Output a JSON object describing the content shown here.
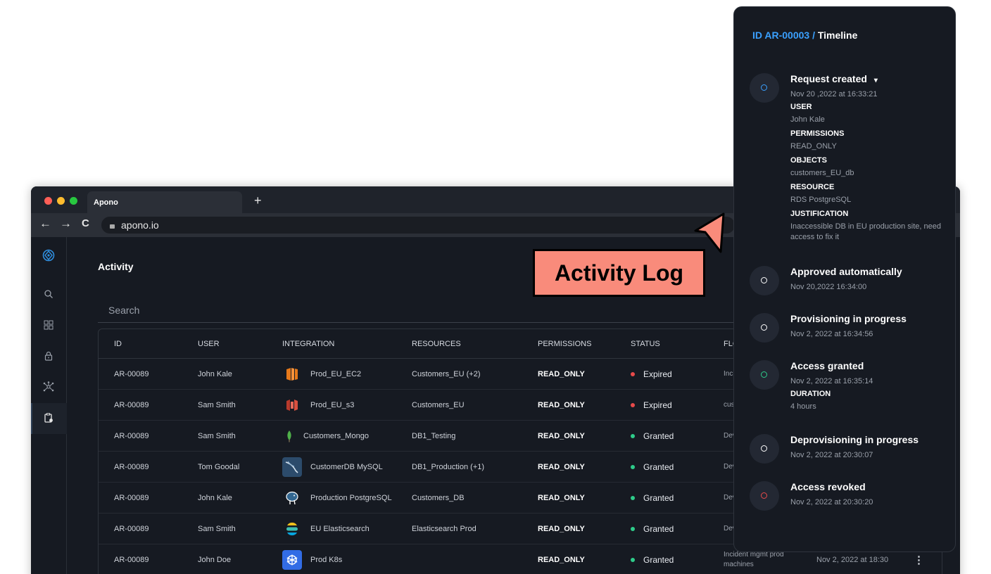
{
  "browser": {
    "tab_title": "Apono",
    "new_tab": "+",
    "url": "apono.io",
    "back": "←",
    "forward": "→",
    "reload": "C"
  },
  "page": {
    "title": "Activity",
    "search_placeholder": "Search"
  },
  "table": {
    "columns": [
      "ID",
      "USER",
      "INTEGRATION",
      "RESOURCES",
      "PERMISSIONS",
      "STATUS",
      "FLO"
    ],
    "rows": [
      {
        "id": "AR-00089",
        "user": "John Kale",
        "integration": "Prod_EU_EC2",
        "icon": "aws-ec2-icon",
        "resources": "Customers_EU (+2)",
        "permissions": "READ_ONLY",
        "status": "Expired",
        "flow": "Inci ma",
        "date": ""
      },
      {
        "id": "AR-00089",
        "user": "Sam Smith",
        "integration": "Prod_EU_s3",
        "icon": "aws-s3-icon",
        "resources": "Customers_EU",
        "permissions": "READ_ONLY",
        "status": "Expired",
        "flow": "cus buc",
        "date": ""
      },
      {
        "id": "AR-00089",
        "user": "Sam Smith",
        "integration": "Customers_Mongo",
        "icon": "mongodb-icon",
        "resources": "DB1_Testing",
        "permissions": "READ_ONLY",
        "status": "Granted",
        "flow": "Dev Res",
        "date": ""
      },
      {
        "id": "AR-00089",
        "user": "Tom Goodal",
        "integration": "CustomerDB MySQL",
        "icon": "mysql-icon",
        "resources": "DB1_Production (+1)",
        "permissions": "READ_ONLY",
        "status": "Granted",
        "flow": "Dev Cu",
        "date": ""
      },
      {
        "id": "AR-00089",
        "user": "John Kale",
        "integration": "Production PostgreSQL",
        "icon": "postgresql-icon",
        "resources": "Customers_DB",
        "permissions": "READ_ONLY",
        "status": "Granted",
        "flow": "Dev Cu",
        "date": ""
      },
      {
        "id": "AR-00089",
        "user": "Sam Smith",
        "integration": "EU Elasticsearch",
        "icon": "elasticsearch-icon",
        "resources": "Elasticsearch Prod",
        "permissions": "READ_ONLY",
        "status": "Granted",
        "flow": "Dev Res",
        "date": ""
      },
      {
        "id": "AR-00089",
        "user": "John Doe",
        "integration": "Prod K8s",
        "icon": "kubernetes-icon",
        "resources": "",
        "permissions": "READ_ONLY",
        "status": "Granted",
        "flow": "Incident mgmt prod machines",
        "date": "Nov 2, 2022 at 18:30"
      }
    ],
    "kebab": "⋮"
  },
  "colors": {
    "expired": "#e84a4a",
    "granted": "#2ecc8a",
    "accent": "#3aa0ff",
    "callout": "#f98b7b"
  },
  "callout": {
    "label": "Activity Log"
  },
  "timeline": {
    "id": "ID AR-00003",
    "separator": " / ",
    "title": "Timeline",
    "events": [
      {
        "title": "Request created",
        "caret": "▾",
        "date": "Nov 20 ,2022 at 16:33:21",
        "color": "#3aa0ff",
        "fields": [
          {
            "k": "USER",
            "v": "John Kale"
          },
          {
            "k": "PERMISSIONS",
            "v": "READ_ONLY"
          },
          {
            "k": "OBJECTS",
            "v": "customers_EU_db"
          },
          {
            "k": "RESOURCE",
            "v": "RDS PostgreSQL"
          },
          {
            "k": "JUSTIFICATION",
            "v": "Inaccessible DB in EU production site, need access to fix it"
          }
        ]
      },
      {
        "title": "Approved automatically",
        "date": "Nov 20,2022 16:34:00",
        "color": "#ffffff",
        "fields": []
      },
      {
        "title": "Provisioning in progress",
        "date": "Nov 2, 2022 at 16:34:56",
        "color": "#ffffff",
        "fields": []
      },
      {
        "title": "Access granted",
        "date": "Nov 2, 2022 at 16:35:14",
        "color": "#2ecc8a",
        "fields": [
          {
            "k": "DURATION",
            "v": "4 hours"
          }
        ]
      },
      {
        "title": "Deprovisioning in progress",
        "date": "Nov 2, 2022 at 20:30:07",
        "color": "#ffffff",
        "fields": []
      },
      {
        "title": "Access revoked",
        "date": "Nov 2, 2022 at 20:30:20",
        "color": "#e84a4a",
        "fields": []
      }
    ]
  }
}
